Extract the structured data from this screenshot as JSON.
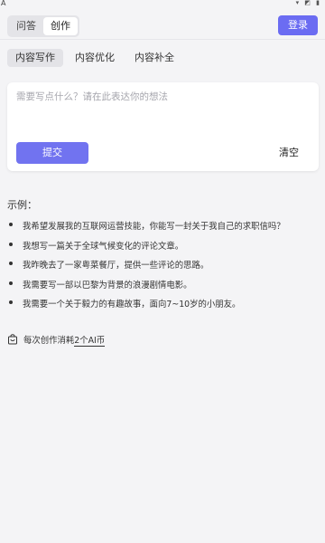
{
  "statusbar": {
    "left_glyph": "A",
    "right_icons": "▾ ◩ ▮"
  },
  "header": {
    "modes": [
      {
        "label": "问答",
        "active": false
      },
      {
        "label": "创作",
        "active": true
      }
    ],
    "login_label": "登录"
  },
  "subtabs": [
    {
      "label": "内容写作",
      "active": true
    },
    {
      "label": "内容优化",
      "active": false
    },
    {
      "label": "内容补全",
      "active": false
    }
  ],
  "input": {
    "placeholder": "需要写点什么？请在此表达你的想法",
    "value": "",
    "submit_label": "提交",
    "clear_label": "清空"
  },
  "examples": {
    "title": "示例：",
    "items": [
      "我希望发展我的互联网运营技能，你能写一封关于我自己的求职信吗？",
      "我想写一篇关于全球气候变化的评论文章。",
      "我昨晚去了一家粤菜餐厅，提供一些评论的思路。",
      "我需要写一部以巴黎为背景的浪漫剧情电影。",
      "我需要一个关于毅力的有趣故事，面向7~10岁的小朋友。"
    ]
  },
  "cost": {
    "prefix": "每次创作消耗 ",
    "amount": "2个AI币"
  },
  "colors": {
    "accent": "#6b6cf2",
    "background": "#f4f4f6"
  }
}
